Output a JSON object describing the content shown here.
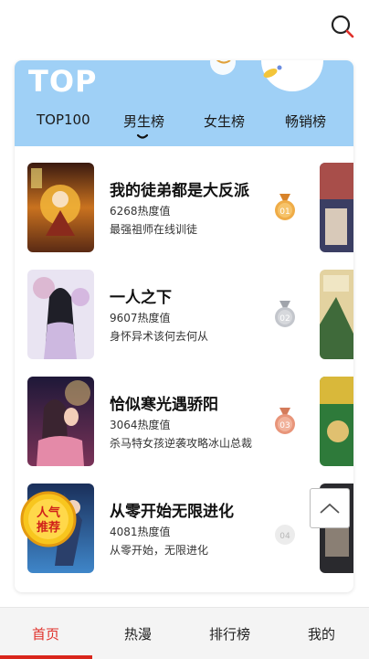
{
  "header": {
    "search_icon": "search-icon"
  },
  "ranking": {
    "banner_title": "TOP",
    "tabs": [
      {
        "label": "TOP100"
      },
      {
        "label": "男生榜"
      },
      {
        "label": "女生榜"
      },
      {
        "label": "畅销榜"
      }
    ],
    "selected_tab": "男生榜",
    "items": [
      {
        "title": "我的徒弟都是大反派",
        "heat": "6268热度值",
        "desc": "最强祖师在线训徒",
        "rank": "01",
        "medal_color": "#e8a13a"
      },
      {
        "title": "一人之下",
        "heat": "9607热度值",
        "desc": "身怀异术该何去何从",
        "rank": "02",
        "medal_color": "#b9bcc2"
      },
      {
        "title": "恰似寒光遇骄阳",
        "heat": "3064热度值",
        "desc": "杀马特女孩逆袭攻略冰山总裁",
        "rank": "03",
        "medal_color": "#e59a7c"
      },
      {
        "title": "从零开始无限进化",
        "heat": "4081热度值",
        "desc": "从零开始，无限进化",
        "rank": "04",
        "medal_color": "#d9d9d9"
      }
    ],
    "badge": {
      "line1": "人气",
      "line2": "推荐"
    }
  },
  "bottom_nav": {
    "items": [
      {
        "label": "首页"
      },
      {
        "label": "热漫"
      },
      {
        "label": "排行榜"
      },
      {
        "label": "我的"
      }
    ],
    "active": "首页",
    "accent": "#d9261c"
  }
}
